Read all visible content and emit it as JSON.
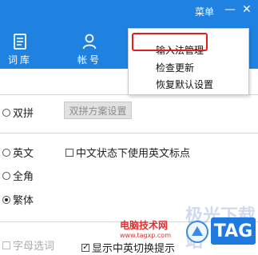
{
  "header": {
    "menu_label": "菜单",
    "minimize_glyph": "—",
    "close_glyph": "✕",
    "nav": [
      {
        "label": "词库",
        "icon": "book-icon"
      },
      {
        "label": "帐号",
        "icon": "user-icon"
      }
    ]
  },
  "dropdown": {
    "items": [
      "输入法管理",
      "检查更新",
      "恢复默认设置"
    ],
    "highlighted_item": "输入法管理"
  },
  "settings": {
    "shuangpin_label": "双拼",
    "shuangpin_button": "双拼方案设置",
    "english_label": "英文",
    "punct_label": "中文状态下使用英文标点",
    "fullwidth_label": "全角",
    "traditional_label": "繁体",
    "letter_select_label": "字母选词",
    "show_switch_label": "显示中英切换提示"
  },
  "watermark": {
    "site": "电脑技术网",
    "faint": "极光下载站",
    "url": "www.tagxp.com",
    "tag": "TAG"
  },
  "colors": {
    "header_bg": "#1f82e0",
    "highlight_border": "#e02020"
  }
}
